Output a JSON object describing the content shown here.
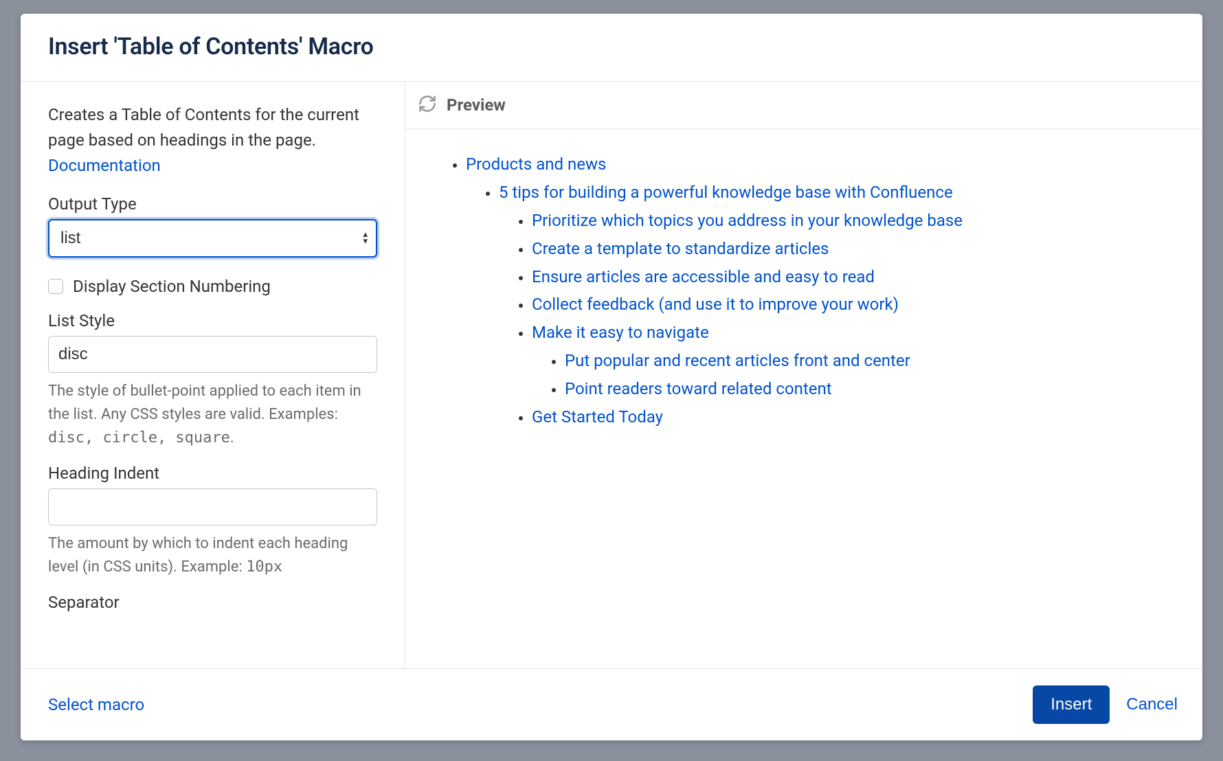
{
  "modal": {
    "title": "Insert 'Table of Contents' Macro",
    "description_prefix": "Creates a Table of Contents for the current page based on headings in the page. ",
    "documentation_link": "Documentation"
  },
  "form": {
    "output_type": {
      "label": "Output Type",
      "value": "list"
    },
    "display_section_numbering": {
      "label": "Display Section Numbering",
      "checked": false
    },
    "list_style": {
      "label": "List Style",
      "value": "disc",
      "help_prefix": "The style of bullet-point applied to each item in the list. Any CSS styles are valid. Examples: ",
      "help_codes": "disc, circle, square",
      "help_suffix": "."
    },
    "heading_indent": {
      "label": "Heading Indent",
      "value": "",
      "help_prefix": "The amount by which to indent each heading level (in CSS units). Example: ",
      "help_code": "10px"
    },
    "separator": {
      "label": "Separator"
    }
  },
  "preview": {
    "title": "Preview",
    "items": {
      "l1": "Products and news",
      "l2": "5 tips for building a powerful knowledge base with Confluence",
      "l3a": "Prioritize which topics you address in your knowledge base",
      "l3b": "Create a template to standardize articles",
      "l3c": "Ensure articles are accessible and easy to read",
      "l3d": "Collect feedback (and use it to improve your work)",
      "l3e": "Make it easy to navigate",
      "l4a": "Put popular and recent articles front and center",
      "l4b": "Point readers toward related content",
      "l3f": "Get Started Today"
    }
  },
  "footer": {
    "select_macro": "Select macro",
    "insert": "Insert",
    "cancel": "Cancel"
  }
}
